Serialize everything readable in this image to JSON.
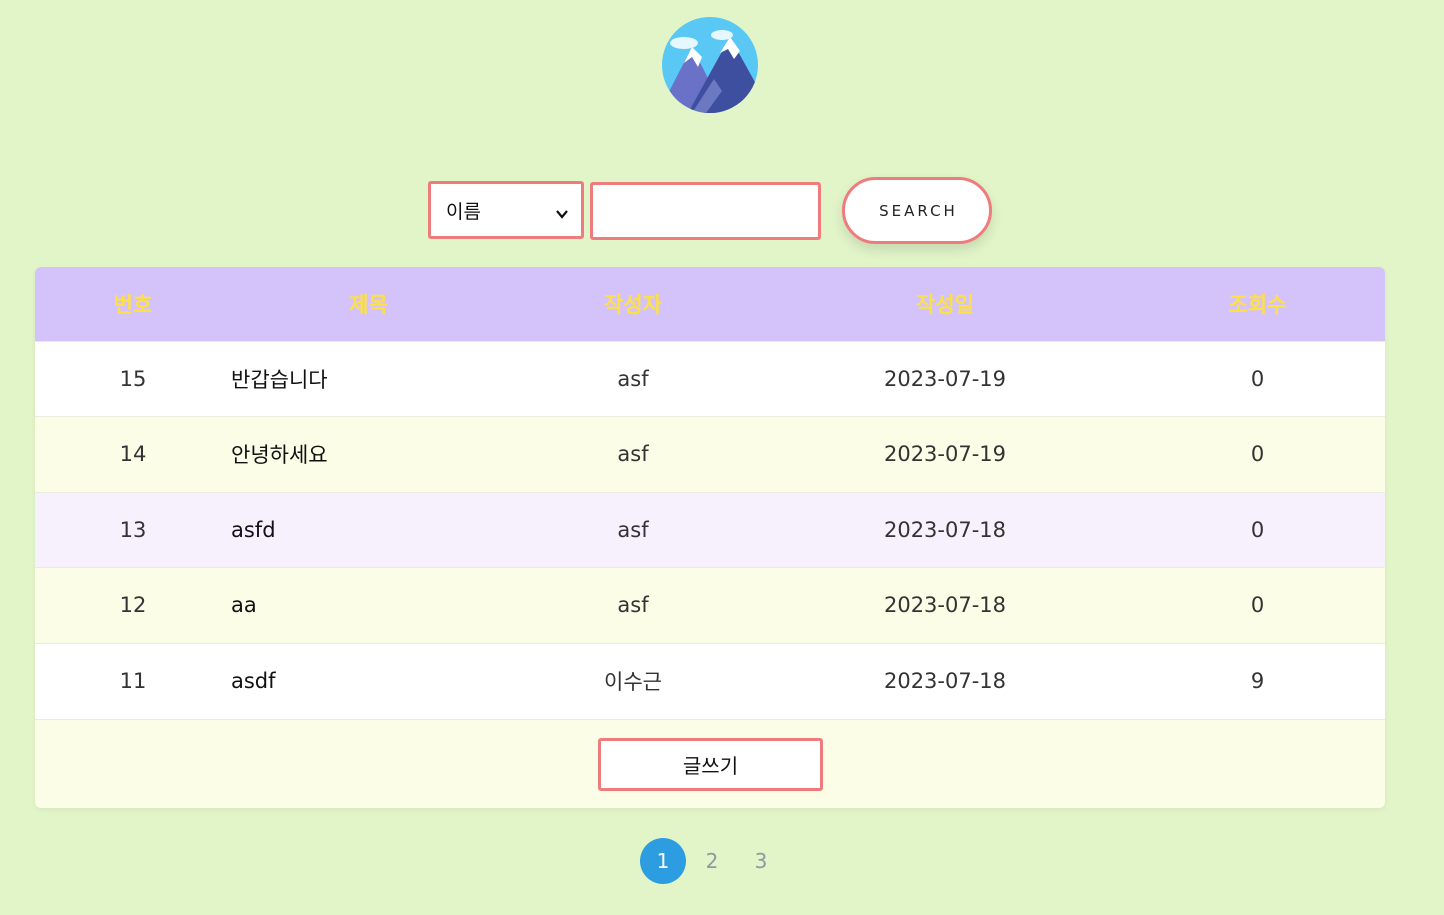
{
  "search": {
    "field_options": [
      "이름"
    ],
    "selected_field": "이름",
    "query_value": "",
    "button_label": "SEARCH"
  },
  "table": {
    "headers": [
      "번호",
      "제목",
      "작성자",
      "작성일",
      "조회수"
    ],
    "rows": [
      {
        "no": "15",
        "title": "반갑습니다",
        "author": "asf",
        "date": "2023-07-19",
        "views": "0"
      },
      {
        "no": "14",
        "title": "안녕하세요",
        "author": "asf",
        "date": "2023-07-19",
        "views": "0"
      },
      {
        "no": "13",
        "title": "asfd",
        "author": "asf",
        "date": "2023-07-18",
        "views": "0"
      },
      {
        "no": "12",
        "title": "aa",
        "author": "asf",
        "date": "2023-07-18",
        "views": "0"
      },
      {
        "no": "11",
        "title": "asdf",
        "author": "이수근",
        "date": "2023-07-18",
        "views": "9"
      }
    ],
    "row_colors": [
      "#ffffff",
      "#fbfde6",
      "#f7f0fd",
      "#fbfde6",
      "#ffffff"
    ],
    "write_label": "글쓰기"
  },
  "pagination": {
    "pages": [
      "1",
      "2",
      "3"
    ],
    "current": "1"
  },
  "colors": {
    "background": "#e2f5c9",
    "header_bg": "#d4c3fa",
    "header_text": "#fde047",
    "accent_border": "#ef7c7c",
    "pager_active": "#2b9de0"
  },
  "icons": {
    "logo": "mountain-logo-icon",
    "select_arrow": "chevron-down-icon"
  }
}
